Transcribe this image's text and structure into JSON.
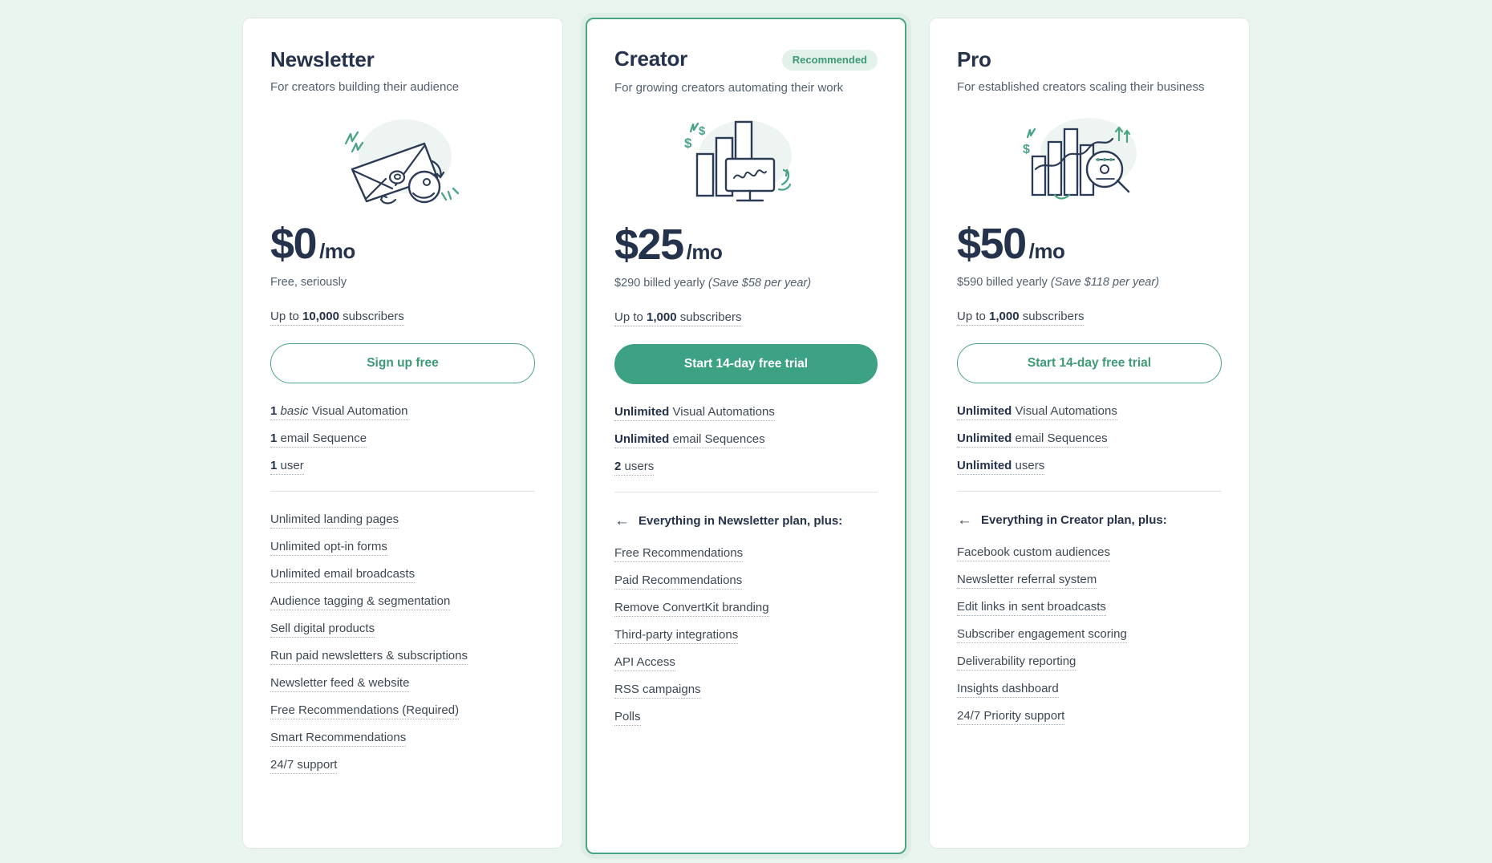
{
  "page": {
    "background": "#eaf4ef",
    "accent": "#3da183",
    "heading_color": "#24324b"
  },
  "plans": [
    {
      "name": "Newsletter",
      "tagline": "For creators building their audience",
      "badge": null,
      "illustration": "envelope-megaphone-illustration",
      "price_amount": "$0",
      "price_per": "/mo",
      "price_note_main": "Free, seriously",
      "price_note_italic": "",
      "subscribers_prefix": "Up to ",
      "subscribers_count": "10,000",
      "subscribers_suffix": " subscribers",
      "cta_label": "Sign up free",
      "cta_style": "outline",
      "top_features": [
        {
          "bold": "1",
          "italic": " basic",
          "rest": " Visual Automation"
        },
        {
          "bold": "1",
          "italic": "",
          "rest": " email Sequence"
        },
        {
          "bold": "1",
          "italic": "",
          "rest": " user"
        }
      ],
      "divider": true,
      "plus_row": null,
      "features": [
        "Unlimited landing pages",
        "Unlimited opt-in forms",
        "Unlimited email broadcasts",
        "Audience tagging & segmentation",
        "Sell digital products",
        "Run paid newsletters & subscriptions",
        "Newsletter feed & website",
        "Free Recommendations (Required)",
        "Smart Recommendations",
        "24/7 support"
      ]
    },
    {
      "name": "Creator",
      "tagline": "For growing creators automating their work",
      "badge": "Recommended",
      "illustration": "bar-chart-desk-illustration",
      "price_amount": "$25",
      "price_per": "/mo",
      "price_note_main": "$290 billed yearly ",
      "price_note_italic": "(Save $58 per year)",
      "subscribers_prefix": "Up to ",
      "subscribers_count": "1,000",
      "subscribers_suffix": " subscribers",
      "cta_label": "Start 14-day free trial",
      "cta_style": "solid",
      "top_features": [
        {
          "bold": "Unlimited",
          "italic": "",
          "rest": " Visual Automations"
        },
        {
          "bold": "Unlimited",
          "italic": "",
          "rest": " email Sequences"
        },
        {
          "bold": "2",
          "italic": "",
          "rest": " users"
        }
      ],
      "divider": true,
      "plus_row": "Everything in Newsletter plan, plus:",
      "features": [
        "Free Recommendations",
        "Paid Recommendations",
        "Remove ConvertKit branding",
        "Third-party integrations",
        "API Access",
        "RSS campaigns",
        "Polls"
      ]
    },
    {
      "name": "Pro",
      "tagline": "For established creators scaling their business",
      "badge": null,
      "illustration": "analytics-dashboard-illustration",
      "price_amount": "$50",
      "price_per": "/mo",
      "price_note_main": "$590 billed yearly ",
      "price_note_italic": "(Save $118 per year)",
      "subscribers_prefix": "Up to ",
      "subscribers_count": "1,000",
      "subscribers_suffix": " subscribers",
      "cta_label": "Start 14-day free trial",
      "cta_style": "outline",
      "top_features": [
        {
          "bold": "Unlimited",
          "italic": "",
          "rest": " Visual Automations"
        },
        {
          "bold": "Unlimited",
          "italic": "",
          "rest": " email Sequences"
        },
        {
          "bold": "Unlimited",
          "italic": "",
          "rest": " users"
        }
      ],
      "divider": true,
      "plus_row": "Everything in Creator plan, plus:",
      "features": [
        "Facebook custom audiences",
        "Newsletter referral system",
        "Edit links in sent broadcasts",
        "Subscriber engagement scoring",
        "Deliverability reporting",
        "Insights dashboard",
        "24/7 Priority support"
      ]
    }
  ],
  "icons": {
    "back_arrow": "←"
  }
}
